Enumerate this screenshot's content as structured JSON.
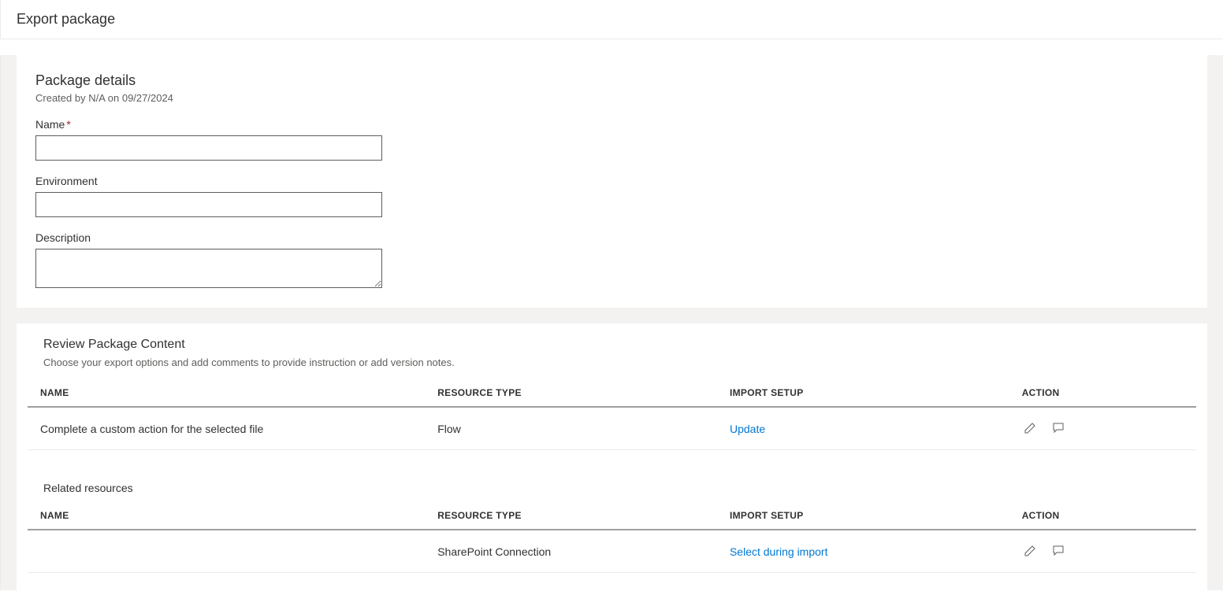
{
  "header": {
    "title": "Export package"
  },
  "details": {
    "title": "Package details",
    "created": "Created by N/A on 09/27/2024",
    "name_label": "Name",
    "name_value": "",
    "env_label": "Environment",
    "env_value": "",
    "desc_label": "Description",
    "desc_value": ""
  },
  "review": {
    "title": "Review Package Content",
    "subtitle": "Choose your export options and add comments to provide instruction or add version notes.",
    "columns": {
      "name": "NAME",
      "type": "RESOURCE TYPE",
      "import": "IMPORT SETUP",
      "action": "ACTION"
    },
    "rows": [
      {
        "name": "Complete a custom action for the selected file",
        "type": "Flow",
        "import": "Update"
      }
    ],
    "related_title": "Related resources",
    "related_rows": [
      {
        "name": "",
        "type": "SharePoint Connection",
        "import": "Select during import"
      }
    ]
  }
}
